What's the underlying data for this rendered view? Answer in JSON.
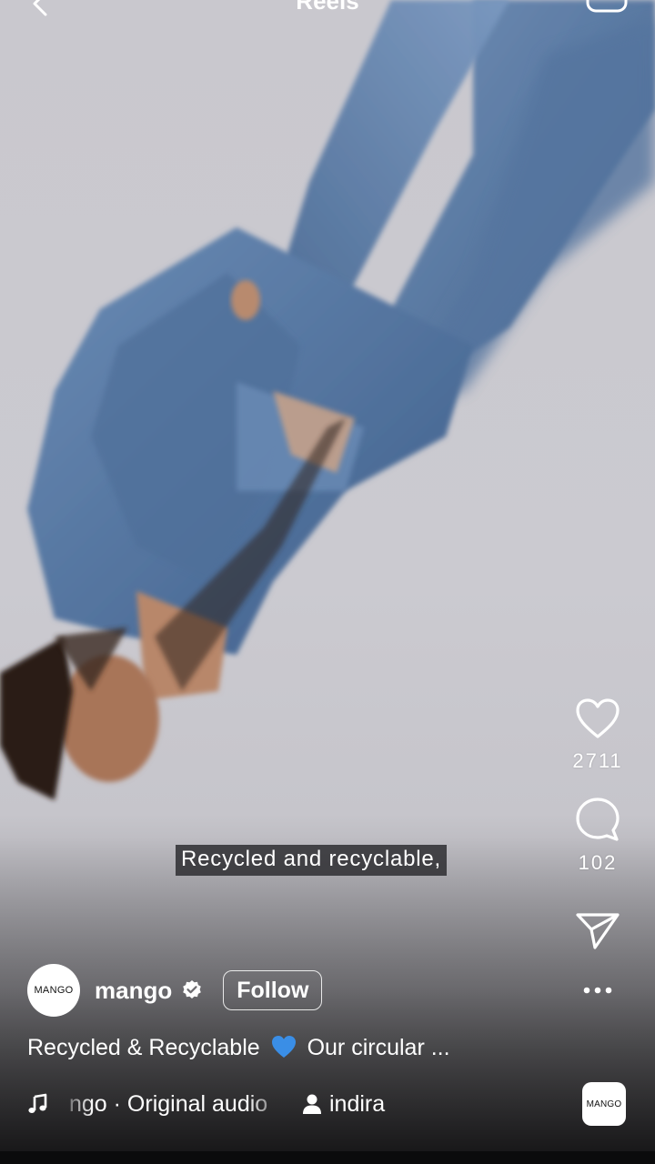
{
  "header": {
    "title": "Reels",
    "back_icon": "chevron-left-icon",
    "camera_icon": "camera-icon"
  },
  "actions": {
    "like_count": "2711",
    "comment_count": "102",
    "like_icon": "heart-outline-icon",
    "comment_icon": "comment-bubble-icon",
    "share_icon": "paper-plane-icon",
    "more_icon": "more-dots-icon"
  },
  "video": {
    "subtitle": "Recycled and recyclable,"
  },
  "author": {
    "avatar_text": "MANGO",
    "username": "mango",
    "follow_label": "Follow"
  },
  "caption": {
    "text_before": "Recycled & Recyclable",
    "emoji": "blue-heart-emoji",
    "text_after": "Our circular ..."
  },
  "audio": {
    "label": "ngo · Original audio",
    "tagged_user": "indira",
    "thumb_text": "MANGO"
  },
  "colors": {
    "background": "#c9c8ce",
    "denim": "#5b7ca8",
    "text": "#ffffff",
    "heart_blue": "#3a8ee6"
  }
}
